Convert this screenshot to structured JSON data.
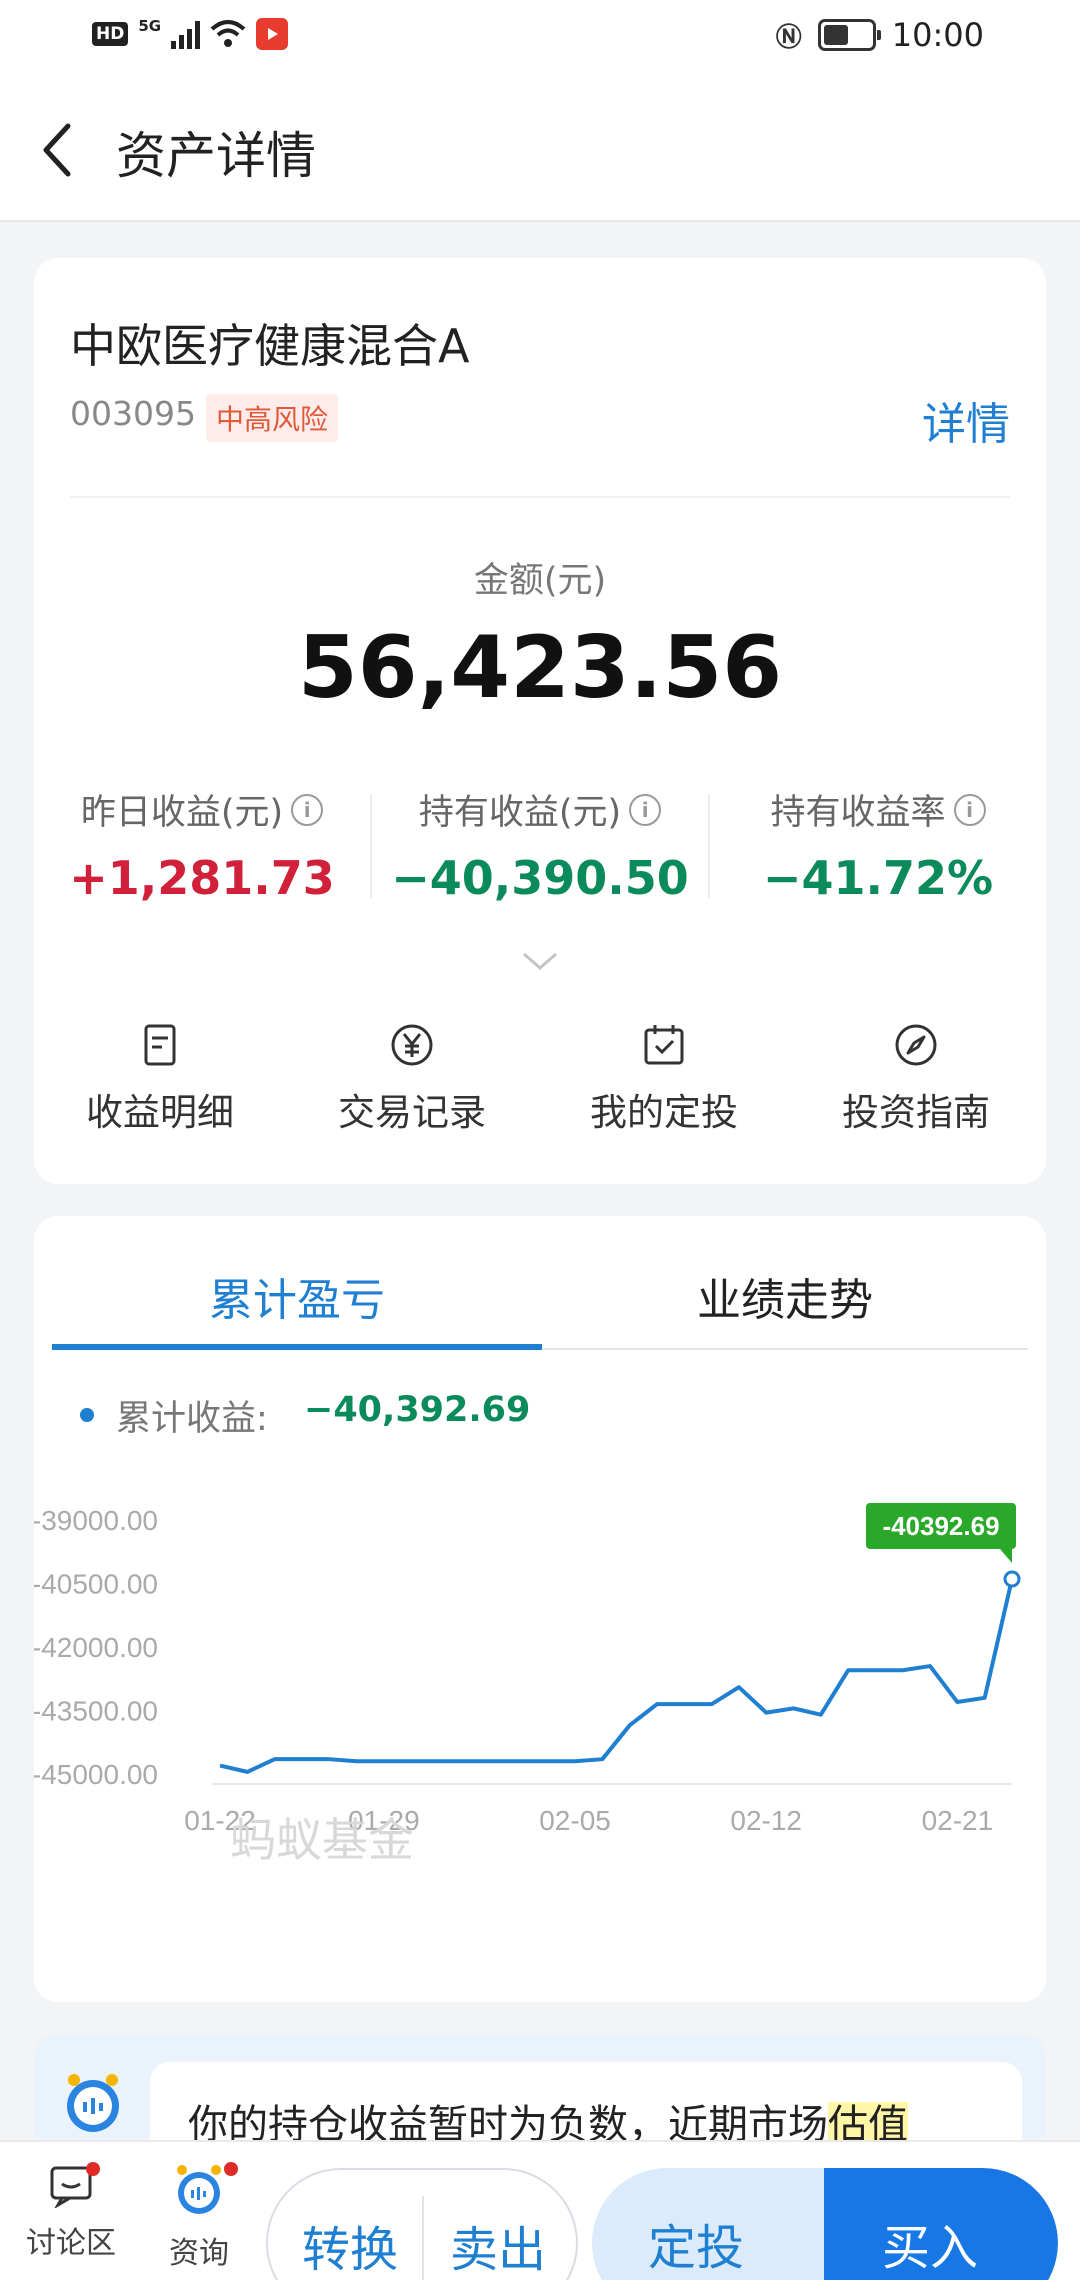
{
  "status_bar": {
    "hd": "HD",
    "network": "5G",
    "time": "10:00"
  },
  "header": {
    "title": "资产详情"
  },
  "fund": {
    "name": "中欧医疗健康混合A",
    "code": "003095",
    "risk": "中高风险",
    "detail_link": "详情",
    "amount_label": "金额(元)",
    "amount": "56,423.56"
  },
  "stats": [
    {
      "label": "昨日收益(元)",
      "value": "+1,281.73",
      "color": "#d0203a"
    },
    {
      "label": "持有收益(元)",
      "value": "−40,390.50",
      "color": "#0b8a5c"
    },
    {
      "label": "持有收益率",
      "value": "−41.72%",
      "color": "#0b8a5c"
    }
  ],
  "actions": [
    {
      "label": "收益明细",
      "icon": "document-icon"
    },
    {
      "label": "交易记录",
      "icon": "yen-circle-icon"
    },
    {
      "label": "我的定投",
      "icon": "calendar-check-icon"
    },
    {
      "label": "投资指南",
      "icon": "compass-icon"
    }
  ],
  "tabs": [
    {
      "label": "累计盈亏",
      "active": true
    },
    {
      "label": "业绩走势",
      "active": false
    }
  ],
  "legend": {
    "label": "累计收益:",
    "value": "−40,392.69"
  },
  "chart_data": {
    "type": "line",
    "y_ticks": [
      "-39000.00",
      "-40500.00",
      "-42000.00",
      "-43500.00",
      "-45000.00"
    ],
    "ylim": [
      -45000,
      -39000
    ],
    "x_ticks": [
      "01-22",
      "01-29",
      "02-05",
      "02-12",
      "02-21"
    ],
    "x_tick_index": [
      0,
      6,
      13,
      20,
      27
    ],
    "x": [
      "01-21",
      "01-22",
      "01-23",
      "01-24",
      "01-25",
      "01-26",
      "01-27",
      "01-28",
      "01-29",
      "01-30",
      "01-31",
      "02-01",
      "02-02",
      "02-03",
      "02-04",
      "02-05",
      "02-06",
      "02-07",
      "02-08",
      "02-09",
      "02-10",
      "02-11",
      "02-12",
      "02-13",
      "02-14",
      "02-15",
      "02-16",
      "02-17",
      "02-18",
      "02-19",
      "02-20",
      "02-21"
    ],
    "values": [
      -44800,
      -44950,
      -44650,
      -44650,
      -44650,
      -44700,
      -44700,
      -44700,
      -44700,
      -44700,
      -44700,
      -44700,
      -44700,
      -44700,
      -44650,
      -43850,
      -43350,
      -43350,
      -43350,
      -42950,
      -43550,
      -43450,
      -43600,
      -42550,
      -42550,
      -42550,
      -42450,
      -43300,
      -43200,
      -40392.69
    ],
    "end_label": "-40392.69",
    "line_color": "#1f7fd0",
    "label_color": "#2aa82a",
    "watermark": "蚂蚁基金"
  },
  "tip": {
    "text_prefix": "你的持仓收益暂时为负数，近期市场",
    "text_highlight": "估值"
  },
  "bottom_bar": {
    "discuss": "讨论区",
    "consult": "资询",
    "convert": "转换",
    "sell": "卖出",
    "auto_invest": "定投",
    "buy": "买入"
  }
}
